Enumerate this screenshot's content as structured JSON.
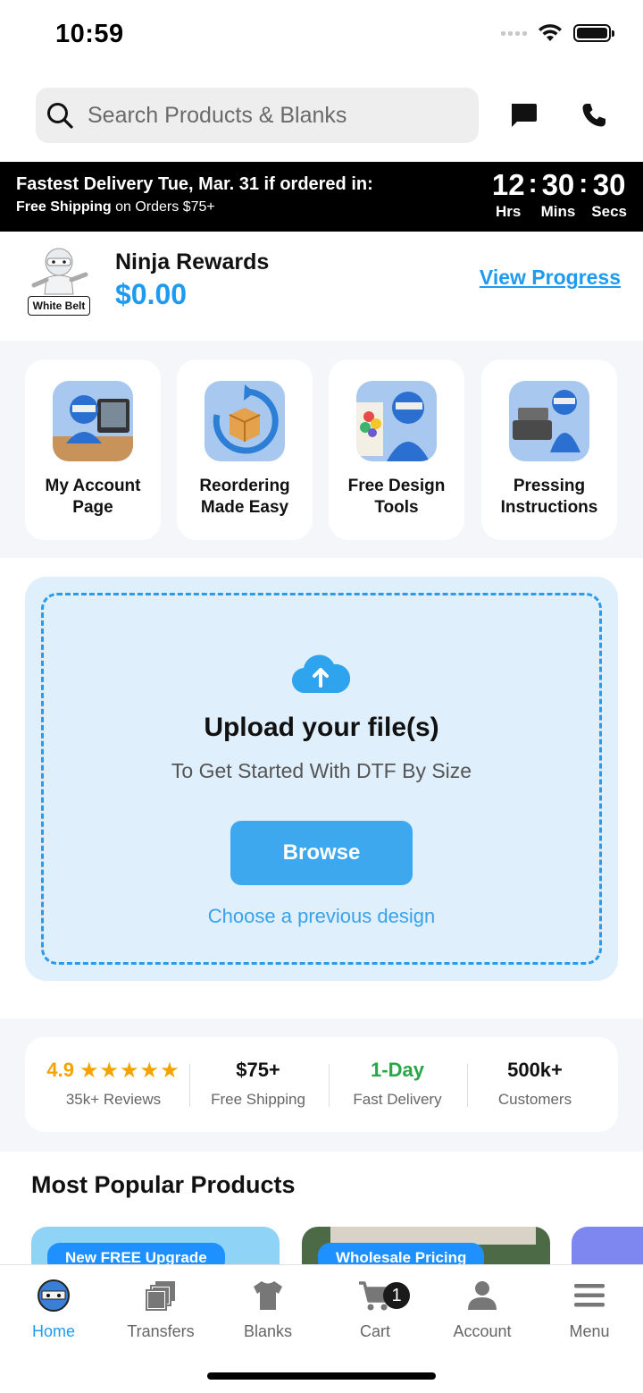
{
  "status_bar": {
    "time": "10:59"
  },
  "search": {
    "placeholder": "Search Products & Blanks"
  },
  "banner": {
    "title": "Fastest Delivery Tue, Mar. 31 if ordered in:",
    "shipping_bold": "Free Shipping",
    "shipping_rest": " on Orders $75+",
    "timer": [
      {
        "value": "12",
        "label": "Hrs"
      },
      {
        "value": "30",
        "label": "Mins"
      },
      {
        "value": "30",
        "label": "Secs"
      }
    ]
  },
  "rewards": {
    "title": "Ninja Rewards",
    "amount": "$0.00",
    "belt": "White Belt",
    "view_progress": "View Progress"
  },
  "quick_links": [
    {
      "line1": "My Account",
      "line2": "Page",
      "icon": "ninja-computer-icon"
    },
    {
      "line1": "Reordering",
      "line2": "Made Easy",
      "icon": "reorder-box-icon"
    },
    {
      "line1": "Free Design",
      "line2": "Tools",
      "icon": "ninja-painting-icon"
    },
    {
      "line1": "Pressing",
      "line2": "Instructions",
      "icon": "ninja-heat-press-icon"
    }
  ],
  "upload": {
    "title": "Upload your file(s)",
    "subtitle": "To Get Started With DTF By Size",
    "browse": "Browse",
    "previous": "Choose a previous design"
  },
  "stats": [
    {
      "top": "4.9",
      "stars": "★★★★★",
      "bottom": "35k+ Reviews"
    },
    {
      "top": "$75+",
      "bottom": "Free Shipping"
    },
    {
      "top": "1-Day",
      "bottom": "Fast Delivery"
    },
    {
      "top": "500k+",
      "bottom": "Customers"
    }
  ],
  "products": {
    "title": "Most Popular Products",
    "cards": [
      {
        "tag": "New FREE Upgrade"
      },
      {
        "tag": "Wholesale Pricing"
      }
    ]
  },
  "tabs": [
    {
      "label": "Home",
      "icon": "ninja-home-icon",
      "active": true
    },
    {
      "label": "Transfers",
      "icon": "layers-icon"
    },
    {
      "label": "Blanks",
      "icon": "tshirt-icon"
    },
    {
      "label": "Cart",
      "icon": "cart-icon",
      "badge": "1"
    },
    {
      "label": "Account",
      "icon": "person-icon"
    },
    {
      "label": "Menu",
      "icon": "hamburger-icon"
    }
  ],
  "colors": {
    "accent": "#1e9bf0",
    "banner_bg": "#000000",
    "rating": "#f5a300",
    "delivery": "#27a745"
  }
}
